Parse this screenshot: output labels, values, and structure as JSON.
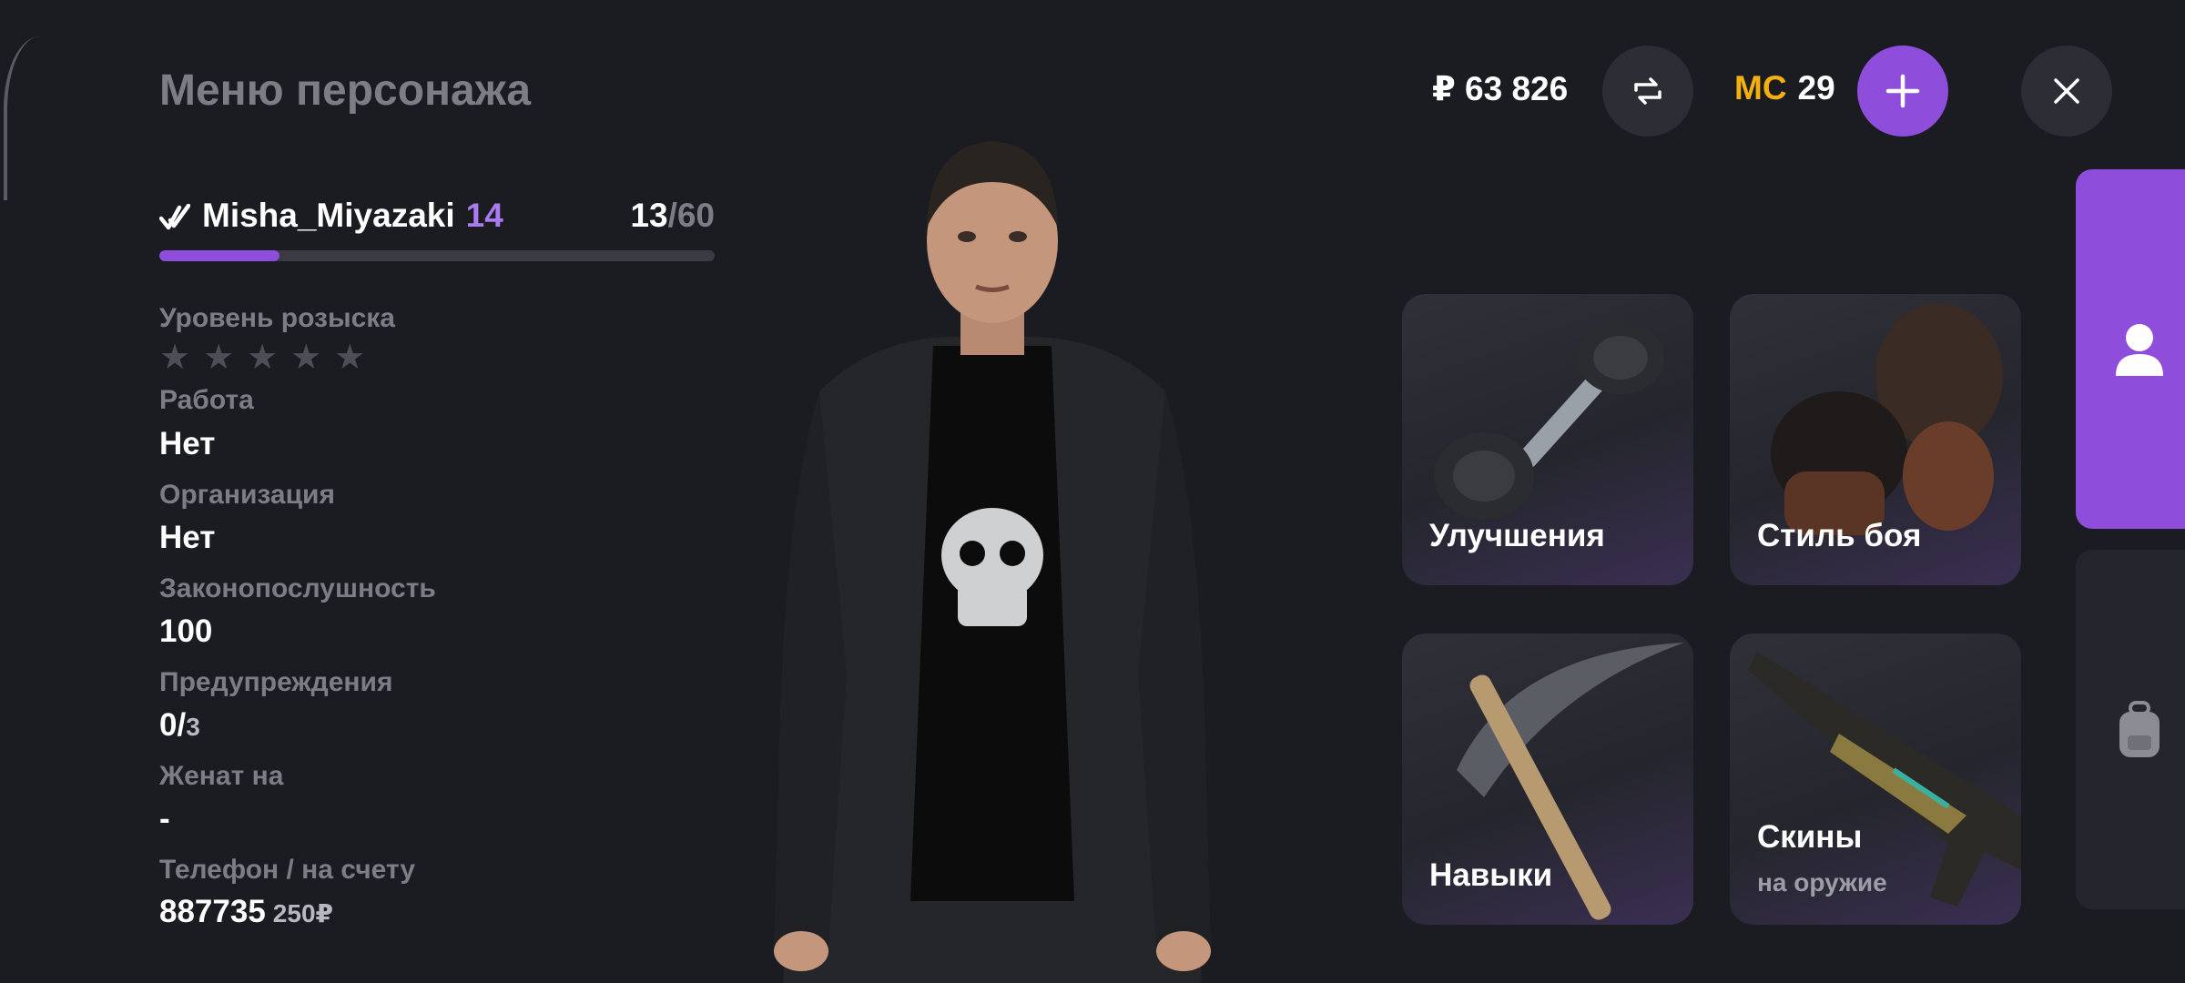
{
  "header": {
    "title": "Меню персонажа",
    "balance": "₽ 63 826",
    "mc_label": "MC",
    "mc_value": "29"
  },
  "player": {
    "name": "Misha_Miyazaki",
    "level": "14",
    "exp_current": "13",
    "exp_max": "/60",
    "exp_progress": 0.217
  },
  "info": {
    "wanted_label": "Уровень розыска",
    "wanted_stars": "★★★★★",
    "wanted_level": 0,
    "job_label": "Работа",
    "job_value": "Нет",
    "org_label": "Организация",
    "org_value": "Нет",
    "law_label": "Законопослушность",
    "law_value": "100",
    "warnings_label": "Предупреждения",
    "warnings_value": "0/",
    "warnings_max": "3",
    "married_label": "Женат на",
    "married_value": "-",
    "phone_label": "Телефон / на счету",
    "phone_value": "887735",
    "phone_balance": "250₽"
  },
  "cards": {
    "upgrades": "Улучшения",
    "fight_style": "Стиль боя",
    "skills": "Навыки",
    "skins": "Скины",
    "skins_sub": "на оружие"
  },
  "icons": {
    "exchange": "exchange-icon",
    "add": "plus-icon",
    "close": "close-icon",
    "profile_tab": "user-icon",
    "inventory_tab": "backpack-icon"
  },
  "colors": {
    "accent": "#8f4ddb",
    "background": "#1b1c22",
    "mc": "#f3b10f"
  }
}
